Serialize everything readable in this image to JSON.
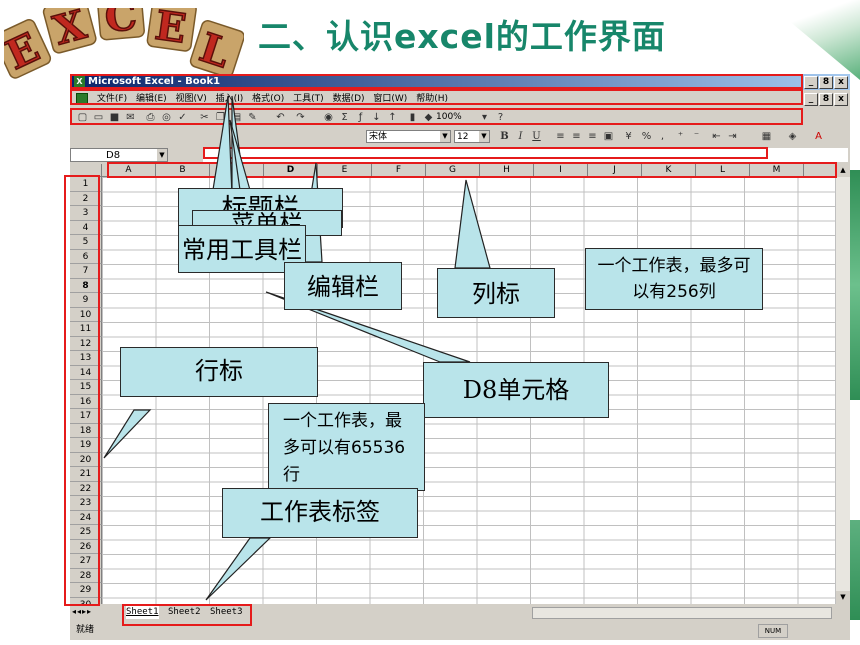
{
  "slide": {
    "title": "二、认识excel的工作界面",
    "logo_letters": [
      "E",
      "X",
      "C",
      "E",
      "L"
    ]
  },
  "excel": {
    "window_title": "Microsoft Excel - Book1",
    "window_buttons": [
      "_",
      "8",
      "x"
    ],
    "menu": [
      "文件(F)",
      "编辑(E)",
      "视图(V)",
      "插入(I)",
      "格式(O)",
      "工具(T)",
      "数据(D)",
      "窗口(W)",
      "帮助(H)"
    ],
    "doc_buttons": [
      "_",
      "8",
      "x"
    ],
    "zoom": "100%",
    "font_name": "宋体",
    "font_size": "12",
    "format_buttons": [
      "B",
      "I",
      "U"
    ],
    "name_box": "D8",
    "columns": [
      "A",
      "B",
      "C",
      "D",
      "E",
      "F",
      "G",
      "H",
      "I",
      "J",
      "K",
      "L",
      "M"
    ],
    "rows": [
      "1",
      "2",
      "3",
      "4",
      "5",
      "6",
      "7",
      "8",
      "9",
      "10",
      "11",
      "12",
      "13",
      "14",
      "15",
      "16",
      "17",
      "18",
      "19",
      "20",
      "21",
      "22",
      "23",
      "24",
      "25",
      "26",
      "27",
      "28",
      "29",
      "30"
    ],
    "active_row": "8",
    "sheet_tabs": [
      "Sheet1",
      "Sheet2",
      "Sheet3"
    ],
    "status": "就绪",
    "num_indicator": "NUM"
  },
  "callouts": {
    "title_bar": "标题栏",
    "menu_bar": "菜单栏",
    "toolbar": "常用工具栏",
    "formula_bar": "编辑栏",
    "column_label": "列标",
    "max_columns": "一个工作表，最多可以有256列",
    "row_label": "行标",
    "cell_d8": "D8单元格",
    "max_rows": "一个工作表，最多可以有65536行",
    "sheet_tab": "工作表标签"
  },
  "colors": {
    "title_green": "#17866a",
    "highlight_red": "#e51b1b",
    "callout_fill": "#b9e4ea"
  }
}
